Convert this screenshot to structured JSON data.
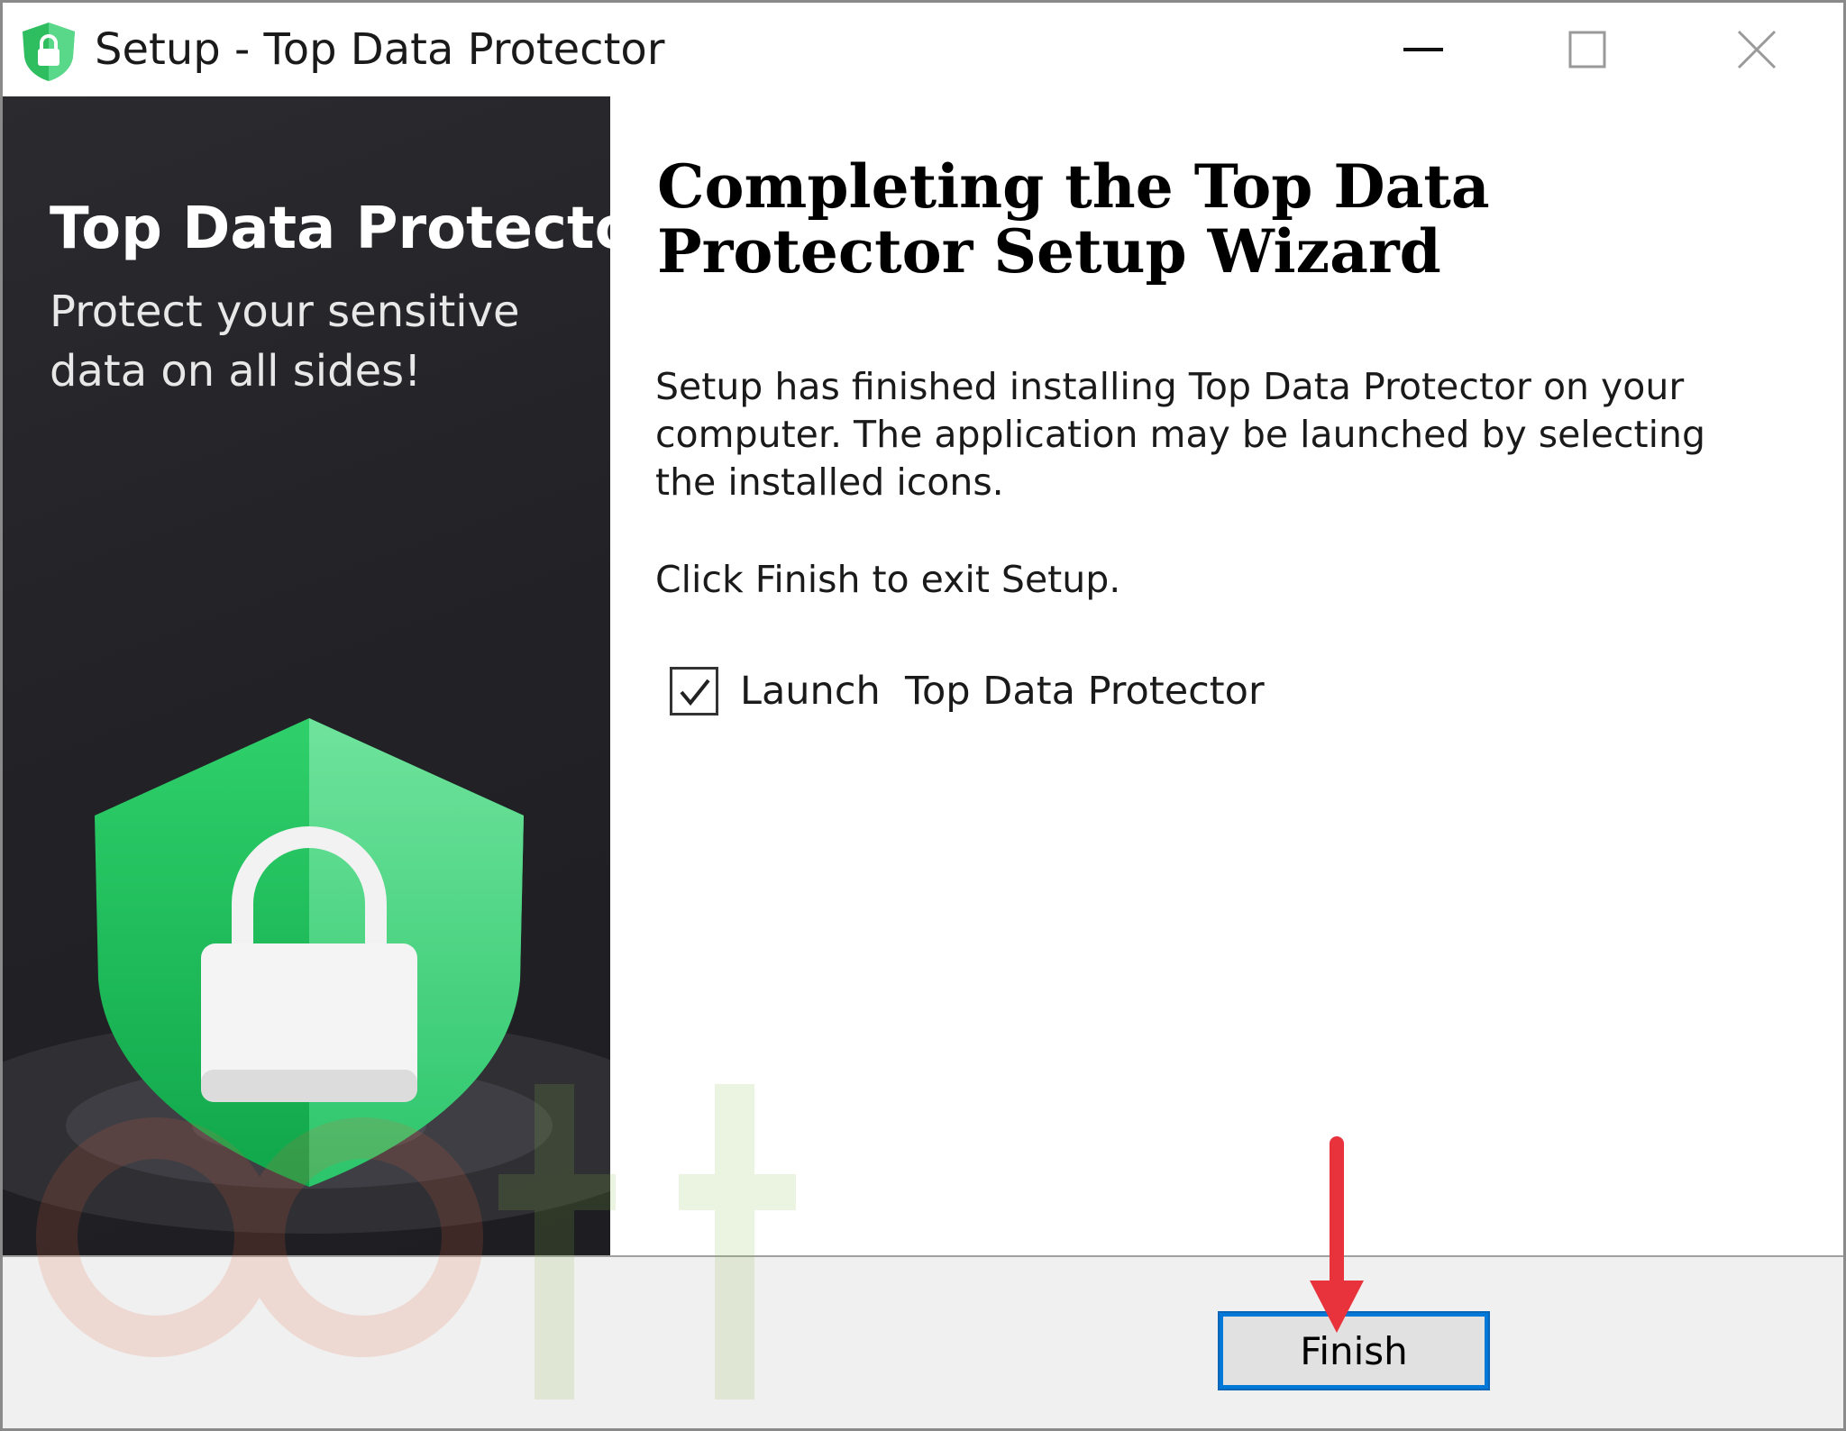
{
  "window": {
    "title": "Setup - Top Data Protector",
    "controls": {
      "minimize": "minimize-icon",
      "maximize": "maximize-icon",
      "close": "close-icon"
    }
  },
  "side_panel": {
    "title": "Top Data Protector",
    "subtitle": "Protect your sensitive data on all sides!",
    "accent_color": "#2ecc71"
  },
  "main": {
    "heading": "Completing the Top Data Protector Setup Wizard",
    "paragraph_1": "Setup has finished installing Top Data Protector on your computer. The application may be launched by selecting the installed icons.",
    "paragraph_2": "Click Finish to exit Setup.",
    "launch_checkbox": {
      "label": "Launch  Top Data Protector",
      "checked": true
    }
  },
  "footer": {
    "finish_label": "Finish"
  },
  "annotation": {
    "arrow_color": "#e8333c"
  }
}
